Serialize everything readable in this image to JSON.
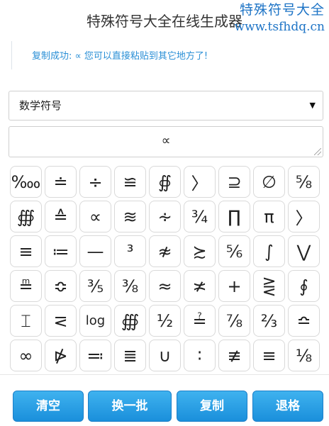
{
  "title": "特殊符号大全在线生成器",
  "watermark": {
    "line1": "特殊符号大全",
    "line2": "www.tsfhdq.cn"
  },
  "status_message": "复制成功: ∝ 您可以直接粘贴到其它地方了!",
  "category_select": {
    "value": "数学符号",
    "arrow": "▼"
  },
  "output_text": "∝",
  "symbols": [
    "‱",
    "≐",
    "÷",
    "≌",
    "∯",
    "〉",
    "⊇",
    "∅",
    "⅝",
    "∰",
    "≙",
    "∝",
    "≋",
    "∻",
    "¾",
    "∏",
    "π",
    "〉",
    "≡",
    "≔",
    "—",
    "³",
    "≉",
    "≿",
    "⅚",
    "∫",
    "⋁",
    "≞",
    "≎",
    "⅗",
    "⅜",
    "≈",
    "≭",
    "+",
    "⋛",
    "∮",
    "⌶",
    "⋜",
    "log",
    "∰",
    "½",
    "≟",
    "⅞",
    "⅔",
    "≏",
    "∞",
    "⋫",
    "≕",
    "≣",
    "∪",
    "∶",
    "≢",
    "≡",
    "⅛"
  ],
  "buttons": {
    "clear": "清空",
    "next_batch": "换一批",
    "copy": "复制",
    "backspace": "退格"
  }
}
